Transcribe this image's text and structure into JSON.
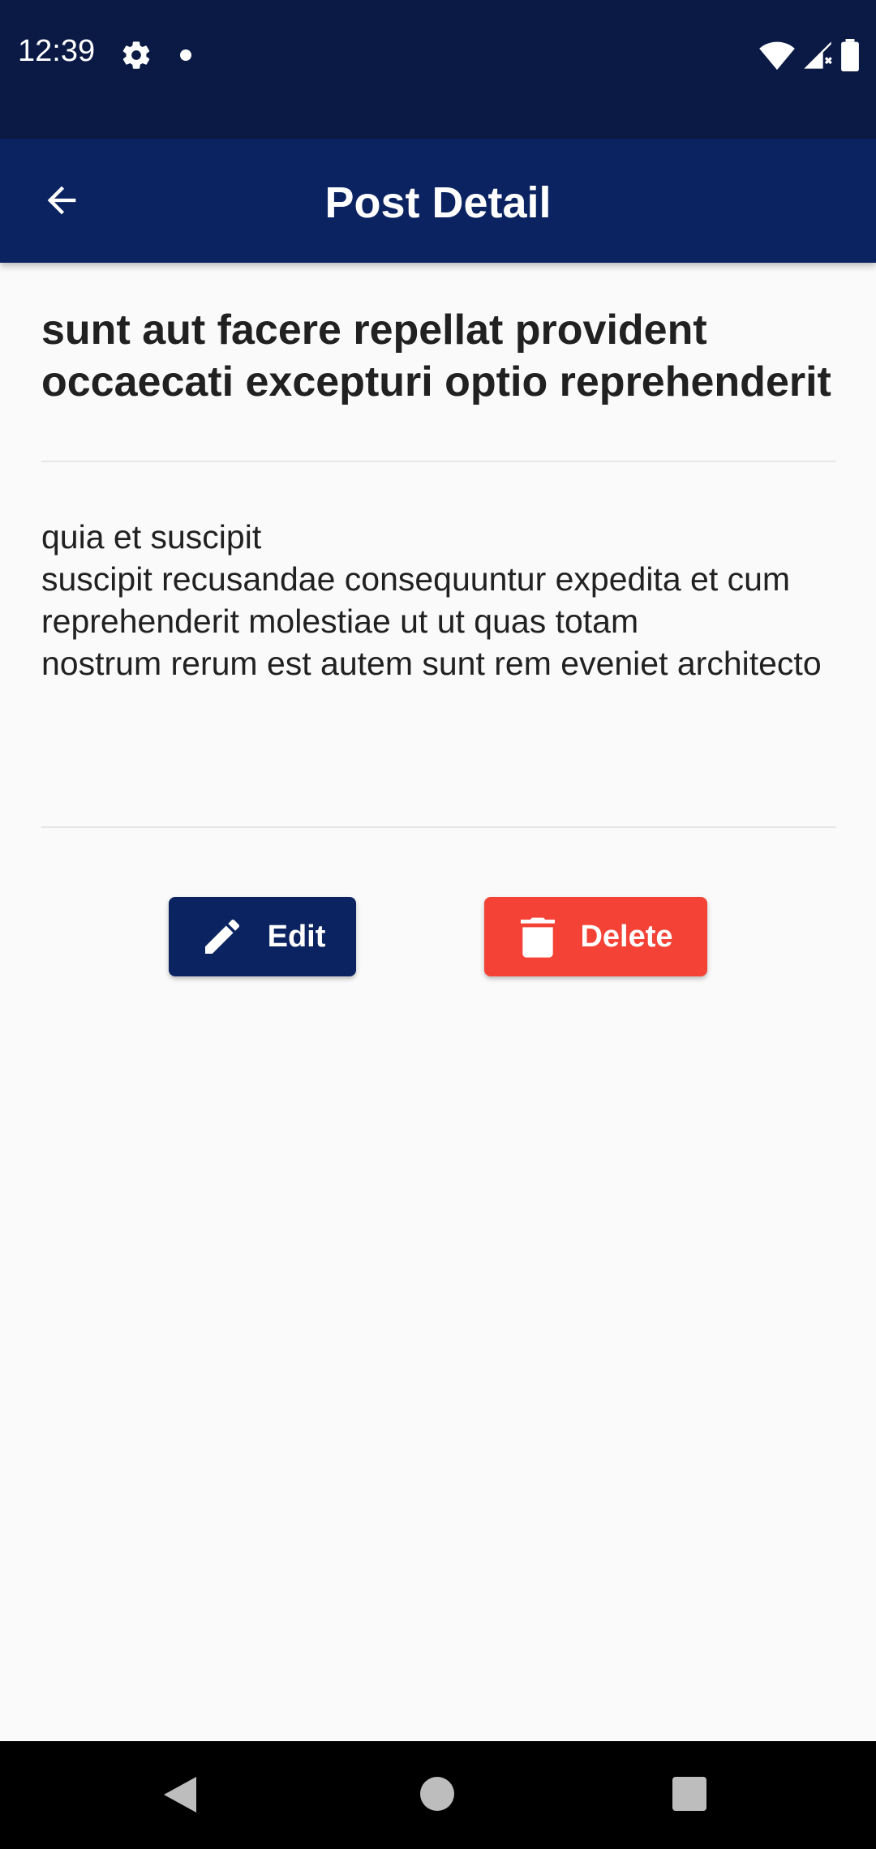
{
  "status_bar": {
    "time": "12:39",
    "icons": [
      "gear-icon",
      "dot-icon",
      "wifi-icon",
      "signal-icon",
      "battery-icon"
    ]
  },
  "app_bar": {
    "title": "Post Detail",
    "back_icon": "arrow-left-icon"
  },
  "post": {
    "title": "sunt aut facere repellat provident occaecati excepturi optio reprehenderit",
    "body": "quia et suscipit\nsuscipit recusandae consequuntur expedita et cum\nreprehenderit molestiae ut ut quas totam\nnostrum rerum est autem sunt rem eveniet architecto"
  },
  "actions": {
    "edit_label": "Edit",
    "edit_icon": "pencil-icon",
    "delete_label": "Delete",
    "delete_icon": "trash-icon"
  },
  "colors": {
    "primary": "#0b2461",
    "status_bar": "#0a1a44",
    "danger": "#f44336",
    "background": "#fafafa"
  },
  "nav_bar": {
    "icons": [
      "nav-back-icon",
      "nav-home-icon",
      "nav-recent-icon"
    ]
  }
}
